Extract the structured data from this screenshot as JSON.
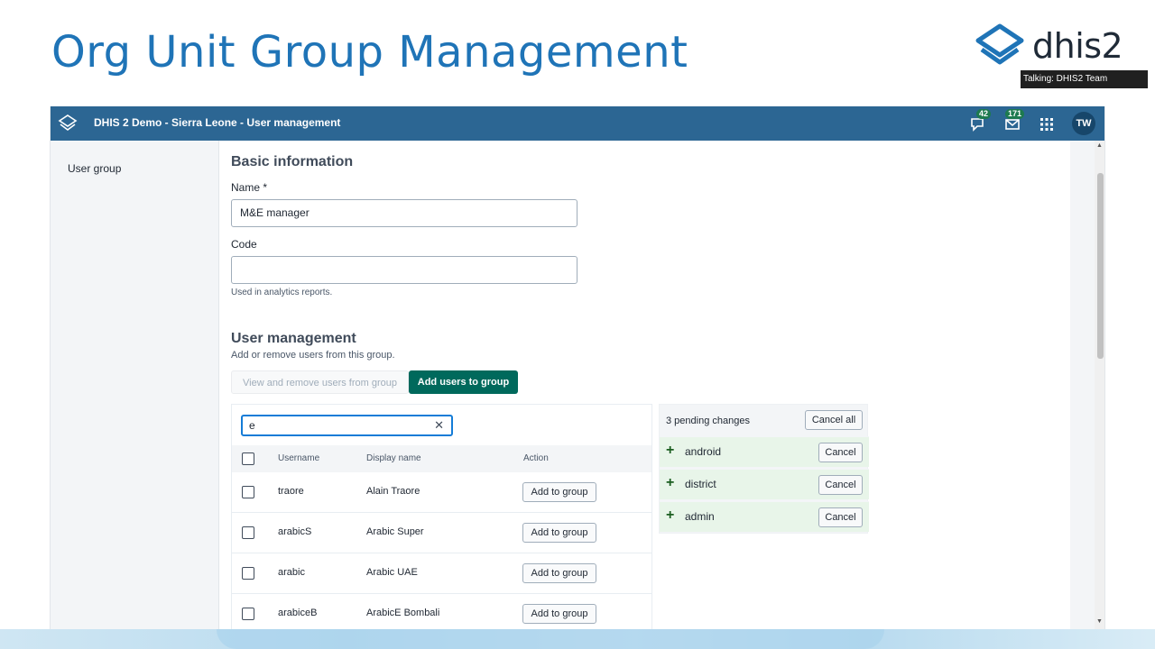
{
  "slide": {
    "title": "Org Unit Group Management"
  },
  "brand": {
    "logo_text": "dhis2",
    "talking": "Talking: DHIS2 Team"
  },
  "header": {
    "title": "DHIS 2 Demo - Sierra Leone - User management",
    "interpretations_badge": "42",
    "messages_badge": "171",
    "avatar_initials": "TW"
  },
  "sidebar": {
    "items": [
      {
        "label": "User group"
      }
    ]
  },
  "basic": {
    "heading": "Basic information",
    "name_label": "Name *",
    "name_value": "M&E manager",
    "code_label": "Code",
    "code_value": "",
    "code_help": "Used in analytics reports."
  },
  "user_mgmt": {
    "heading": "User management",
    "subtitle": "Add or remove users from this group.",
    "tabs": [
      {
        "label": "View and remove users from group"
      },
      {
        "label": "Add users to group"
      }
    ],
    "search_value": "e",
    "columns": {
      "username": "Username",
      "display_name": "Display name",
      "action": "Action"
    },
    "rows": [
      {
        "username": "traore",
        "display_name": "Alain Traore",
        "action": "Add to group"
      },
      {
        "username": "arabicS",
        "display_name": "Arabic Super",
        "action": "Add to group"
      },
      {
        "username": "arabic",
        "display_name": "Arabic UAE",
        "action": "Add to group"
      },
      {
        "username": "arabiceB",
        "display_name": "ArabicE Bombali",
        "action": "Add to group"
      }
    ]
  },
  "pending": {
    "title": "3 pending changes",
    "cancel_all": "Cancel all",
    "items": [
      {
        "name": "android",
        "cancel": "Cancel"
      },
      {
        "name": "district",
        "cancel": "Cancel"
      },
      {
        "name": "admin",
        "cancel": "Cancel"
      }
    ]
  },
  "colors": {
    "accent": "#1f74b7",
    "header": "#2c6693",
    "primary_button": "#00695c",
    "pending_bg": "#e8f5e9"
  }
}
